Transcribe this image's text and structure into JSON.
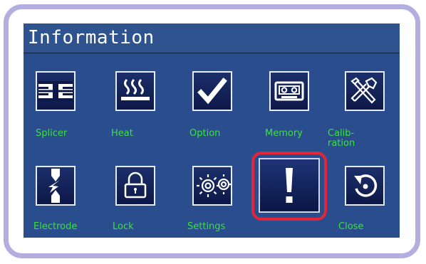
{
  "window": {
    "title": "Information"
  },
  "buttons": {
    "splicer": {
      "label": "Splicer",
      "icon": "splicer-icon"
    },
    "heat": {
      "label": "Heat",
      "icon": "heat-icon"
    },
    "option": {
      "label": "Option",
      "icon": "checkmark-icon"
    },
    "memory": {
      "label": "Memory",
      "icon": "cassette-icon"
    },
    "calibration": {
      "label": "Calib-\nration",
      "icon": "tools-icon"
    },
    "electrode": {
      "label": "Electrode",
      "icon": "electrode-icon"
    },
    "lock": {
      "label": "Lock",
      "icon": "lock-icon"
    },
    "settings": {
      "label": "Settings",
      "icon": "gears-icon"
    },
    "information": {
      "label": "",
      "icon": "exclamation-icon",
      "selected": true
    },
    "close": {
      "label": "Close",
      "icon": "back-arrow-icon"
    }
  },
  "colors": {
    "screen_bg": "#2a4d8d",
    "label_green": "#3be23b",
    "selection_red": "#e3253a",
    "frame_lavender": "#b3aee0"
  }
}
